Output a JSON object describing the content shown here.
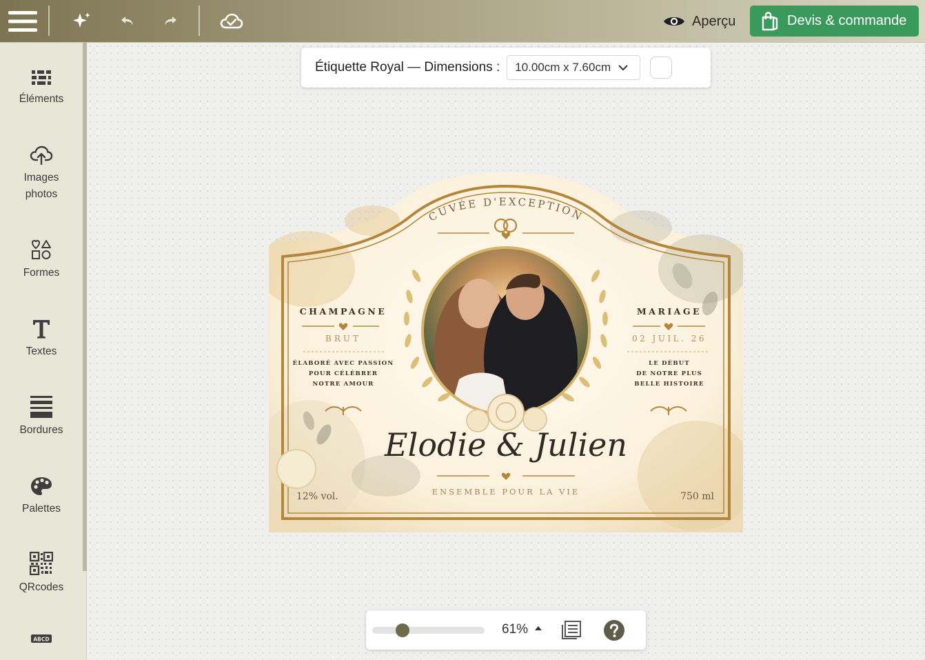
{
  "colors": {
    "topbar_start": "#7c7451",
    "accent_green": "#3a9a5b",
    "gold": "#b4863c",
    "label_bg": "#fbf4e4"
  },
  "toolbar": {
    "menu_icon": "hamburger-icon",
    "magic_icon": "sparkle-icon",
    "undo_icon": "undo-icon",
    "redo_icon": "redo-icon",
    "save_icon": "cloud-check-icon",
    "preview_label": "Aperçu",
    "order_label": "Devis & commande"
  },
  "sidebar": {
    "items": [
      {
        "label": "Éléments",
        "icon": "elements-icon"
      },
      {
        "label": "Images\nphotos",
        "icon": "cloud-upload-icon"
      },
      {
        "label": "Formes",
        "icon": "shapes-icon"
      },
      {
        "label": "Textes",
        "icon": "text-icon"
      },
      {
        "label": "Bordures",
        "icon": "borders-icon"
      },
      {
        "label": "Palettes",
        "icon": "palette-icon"
      },
      {
        "label": "QRcodes",
        "icon": "qrcode-icon"
      },
      {
        "label": "ABCD",
        "icon": "font-icon"
      }
    ]
  },
  "dimensions": {
    "title": "Étiquette Royal — Dimensions :",
    "selected": "10.00cm x 7.60cm"
  },
  "label": {
    "arc_text": "CUVÉE D'EXCEPTION",
    "left": {
      "title": "CHAMPAGNE",
      "subtitle": "BRUT",
      "line1": "ÉLABORÉ AVEC PASSION",
      "line2": "POUR CÉLÉBRER",
      "line3": "NOTRE AMOUR"
    },
    "right": {
      "title": "MARIAGE",
      "subtitle": "02 JUIL. 26",
      "line1": "LE DÉBUT",
      "line2": "DE NOTRE PLUS",
      "line3": "BELLE HISTOIRE"
    },
    "names": "Elodie & Julien",
    "tagline": "ENSEMBLE POUR LA VIE",
    "abv": "12% vol.",
    "volume": "750 ml"
  },
  "zoom": {
    "value_label": "61%",
    "level_fraction": 0.21
  }
}
